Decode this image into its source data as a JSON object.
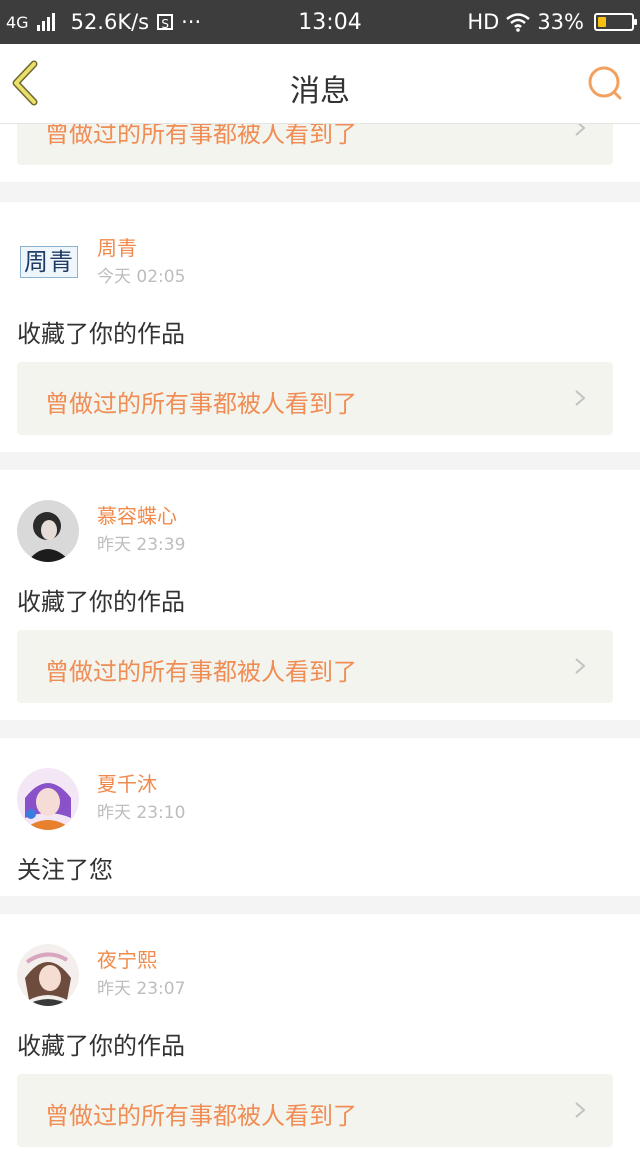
{
  "status_bar": {
    "network": "4G",
    "speed": "52.6K/s",
    "more": "···",
    "time": "13:04",
    "hd": "HD",
    "battery_percent": "33%",
    "battery_level": 0.33,
    "battery_color": "#f6c012"
  },
  "nav": {
    "title": "消息",
    "back_icon": "chevron-left-icon",
    "search_icon": "search-icon",
    "accent": "#e9df6a"
  },
  "feed": {
    "partial_link_title": "曾做过的所有事都被人看到了",
    "items": [
      {
        "username": "周青",
        "avatar_text": "周青",
        "time": "今天 02:05",
        "action": "收藏了你的作品",
        "work_title": "曾做过的所有事都被人看到了"
      },
      {
        "username": "慕容蝶心",
        "time": "昨天 23:39",
        "action": "收藏了你的作品",
        "work_title": "曾做过的所有事都被人看到了"
      },
      {
        "username": "夏千沐",
        "time": "昨天 23:10",
        "action": "关注了您"
      },
      {
        "username": "夜宁熙",
        "time": "昨天 23:07",
        "action": "收藏了你的作品",
        "work_title": "曾做过的所有事都被人看到了"
      }
    ]
  },
  "colors": {
    "username": "#f08a4c",
    "link_title": "#ef8d54",
    "link_bg": "#f4f4ef"
  }
}
